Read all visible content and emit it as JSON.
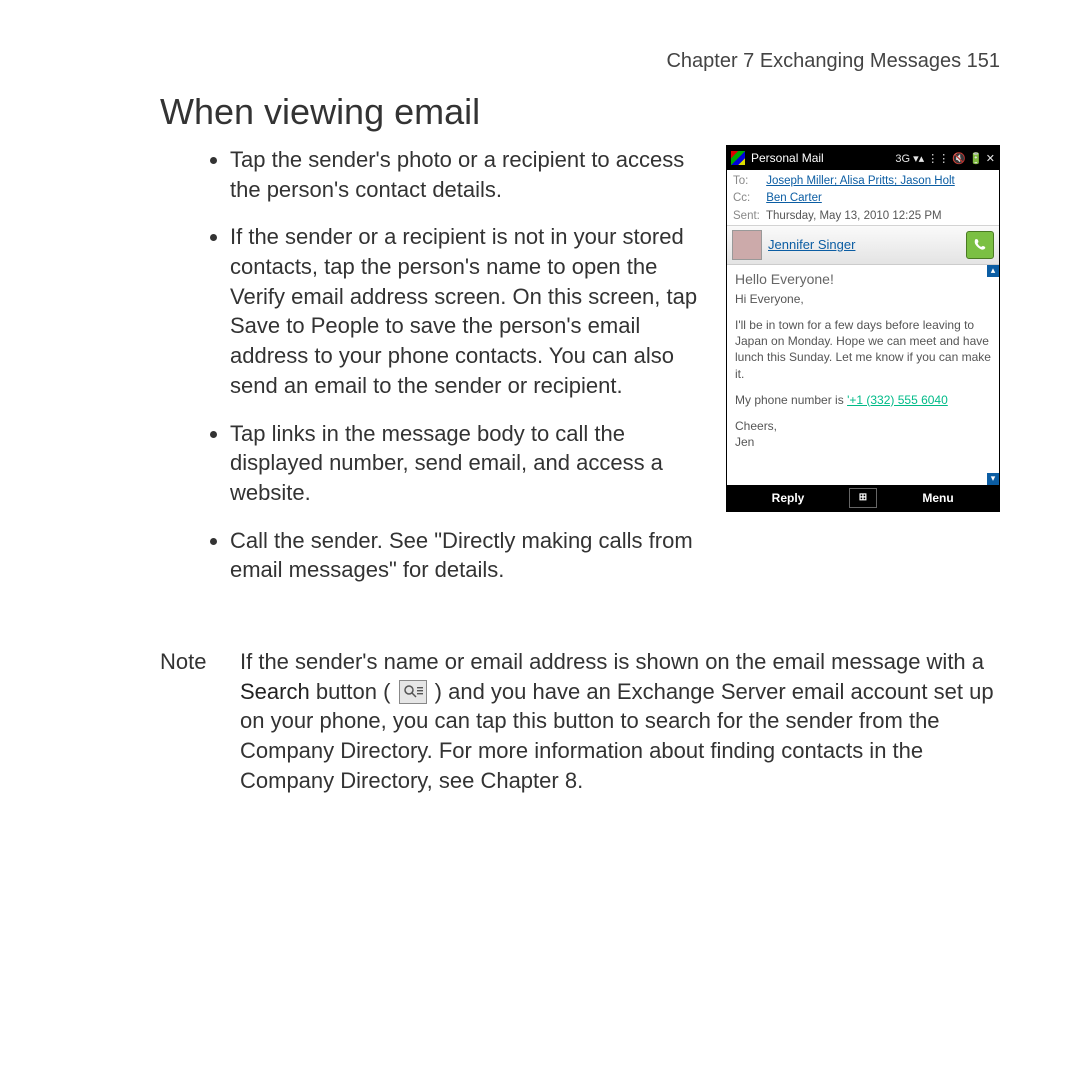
{
  "header": {
    "chapter_line": "Chapter 7  Exchanging Messages  151"
  },
  "section": {
    "title": "When viewing email",
    "bullets": [
      "Tap the sender's photo or a recipient to access the person's contact details.",
      "If the sender or a recipient is not in your stored contacts, tap the person's name to open the Verify email address screen. On this screen, tap Save to People to save the person's email address to your phone contacts. You can also send an email to the sender or recipient.",
      "Tap links in the message body to call the displayed number, send email, and access a website.",
      "Call the sender. See \"Directly making calls from email messages\" for details."
    ]
  },
  "note": {
    "label": "Note",
    "body_pre": "If the sender's name or email address is shown on the email message with a ",
    "bold_word": "Search",
    "body_mid": " button ( ",
    "body_post": " ) and you have an Exchange Server email account set up on your phone, you can tap this button to search for the sender from the Company Directory. For more information about finding contacts in the Company Directory, see Chapter 8."
  },
  "phone": {
    "title": "Personal Mail",
    "status_icons": "3G ▾▴ ⋮⋮ 🔇 🔋 ✕",
    "to_label": "To:",
    "to_value": "Joseph Miller; Alisa Pritts; Jason Holt",
    "cc_label": "Cc:",
    "cc_value": "Ben Carter",
    "sent_label": "Sent:",
    "sent_value": "Thursday, May 13, 2010 12:25 PM",
    "sender_name": "Jennifer Singer",
    "subject": "Hello Everyone!",
    "greeting": "Hi Everyone,",
    "para1": "I'll be in town for a few days before leaving to Japan on Monday. Hope we can meet and have lunch this Sunday. Let me know if you can make it.",
    "para2_pre": "My phone number is ",
    "phone_link": "'+1 (332) 555 6040",
    "signoff1": "Cheers,",
    "signoff2": "Jen",
    "softkey_left": "Reply",
    "softkey_mid": "⊞",
    "softkey_right": "Menu"
  }
}
